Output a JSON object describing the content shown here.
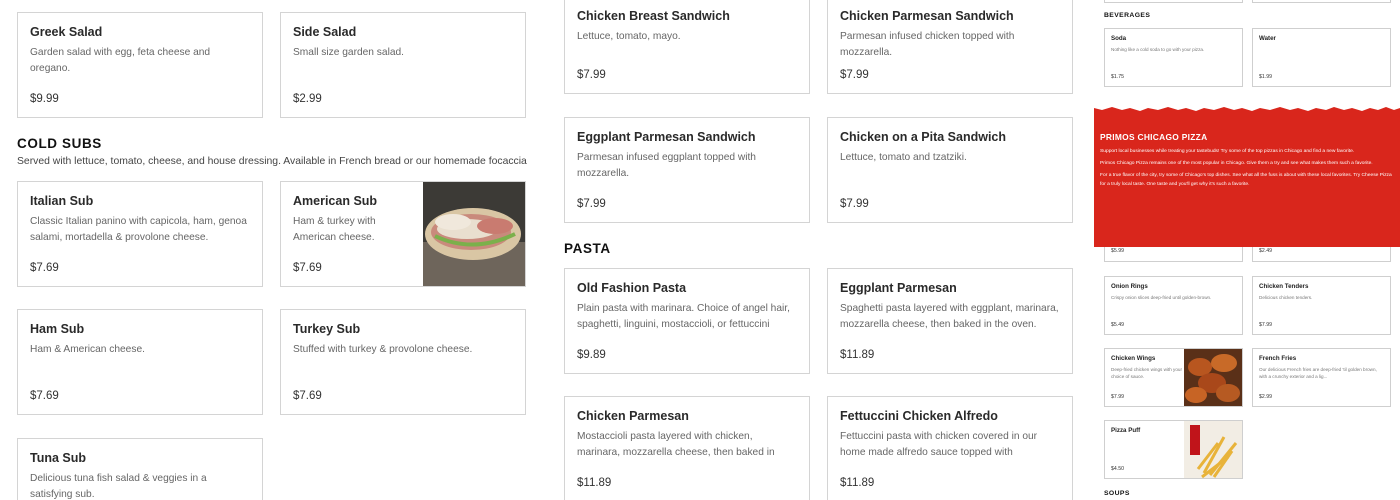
{
  "left": {
    "greek_salad": {
      "title": "Greek Salad",
      "desc": "Garden salad with egg, feta cheese and oregano.",
      "price": "$9.99"
    },
    "side_salad": {
      "title": "Side Salad",
      "desc": "Small size garden salad.",
      "price": "$2.99"
    },
    "cold_subs": {
      "heading": "COLD SUBS",
      "subheading": "Served with lettuce, tomato, cheese, and house dressing. Available in French bread or our homemade focaccia"
    },
    "italian_sub": {
      "title": "Italian Sub",
      "desc": "Classic Italian panino with capicola, ham, genoa salami, mortadella & provolone cheese.",
      "price": "$7.69"
    },
    "american_sub": {
      "title": "American Sub",
      "desc": "Ham & turkey with American cheese.",
      "price": "$7.69"
    },
    "ham_sub": {
      "title": "Ham Sub",
      "desc": "Ham & American cheese.",
      "price": "$7.69"
    },
    "turkey_sub": {
      "title": "Turkey Sub",
      "desc": "Stuffed with turkey & provolone cheese.",
      "price": "$7.69"
    },
    "tuna_sub": {
      "title": "Tuna Sub",
      "desc": "Delicious tuna fish salad & veggies in a satisfying sub.",
      "price": ""
    }
  },
  "middle": {
    "chicken_breast": {
      "title": "Chicken Breast Sandwich",
      "desc": "Lettuce, tomato, mayo.",
      "price": "$7.99"
    },
    "chicken_parm_sandwich": {
      "title": "Chicken Parmesan Sandwich",
      "desc": "Parmesan infused chicken topped with mozzarella.",
      "price": "$7.99"
    },
    "eggplant_parm_sandwich": {
      "title": "Eggplant Parmesan Sandwich",
      "desc": "Parmesan infused eggplant topped with mozzarella.",
      "price": "$7.99"
    },
    "chicken_pita": {
      "title": "Chicken on a Pita Sandwich",
      "desc": "Lettuce, tomato and tzatziki.",
      "price": "$7.99"
    },
    "pasta": {
      "heading": "PASTA"
    },
    "old_fashion_pasta": {
      "title": "Old Fashion Pasta",
      "desc": "Plain pasta with marinara. Choice of angel hair, spaghetti, linguini, mostaccioli, or fettuccini",
      "price": "$9.89"
    },
    "eggplant_parm": {
      "title": "Eggplant Parmesan",
      "desc": "Spaghetti pasta layered with eggplant, marinara, mozzarella cheese, then baked in the oven.",
      "price": "$11.89"
    },
    "chicken_parm": {
      "title": "Chicken Parmesan",
      "desc": "Mostaccioli pasta layered with chicken, marinara, mozzarella cheese, then baked in the...",
      "price": "$11.89"
    },
    "fettuccini": {
      "title": "Fettuccini Chicken Alfredo",
      "desc": "Fettuccini pasta with chicken covered in our home made alfredo sauce topped with parmesa...",
      "price": "$11.89"
    }
  },
  "right": {
    "beverages_heading": "BEVERAGES",
    "soda": {
      "title": "Soda",
      "desc": "Nothing like a cold soda to go with your pizza.",
      "price": "$1.75"
    },
    "water": {
      "title": "Water",
      "desc": "",
      "price": "$1.99"
    },
    "banner": {
      "title": "PRIMOS CHICAGO PIZZA",
      "p1": "Support local businesses while treating your tastebuds! Try some of the top pizzas in Chicago and find a new favorite.",
      "p2": "Primos Chicago Pizza remains one of the most popular in Chicago. Give them a try and see what makes them such a favorite.",
      "p3": "For a true flavor of the city, try some of Chicago's top dishes. See what all the fuss is about with these local favorites. Try Cheese Pizza for a truly local taste. One taste and you'll get why it's such a favorite.",
      "color": "#d9261c"
    },
    "peek_left_price": "$5.99",
    "peek_right_price": "$2.49",
    "onion_rings": {
      "title": "Onion Rings",
      "desc": "Crispy onion slices deep-fried until golden-brown.",
      "price": "$5.49"
    },
    "chicken_tenders": {
      "title": "Chicken Tenders",
      "desc": "Delicious chicken tenders.",
      "price": "$7.99"
    },
    "chicken_wings": {
      "title": "Chicken Wings",
      "desc": "Deep-fried chicken wings with your choice of sauce.",
      "price": "$7.99"
    },
    "french_fries": {
      "title": "French Fries",
      "desc": "Our delicious French fries are deep-fried 'til golden brown, with a crunchy exterior and a lig...",
      "price": "$2.99"
    },
    "pizza_puff": {
      "title": "Pizza Puff",
      "desc": "",
      "price": "$4.50"
    },
    "soups_heading": "SOUPS"
  }
}
